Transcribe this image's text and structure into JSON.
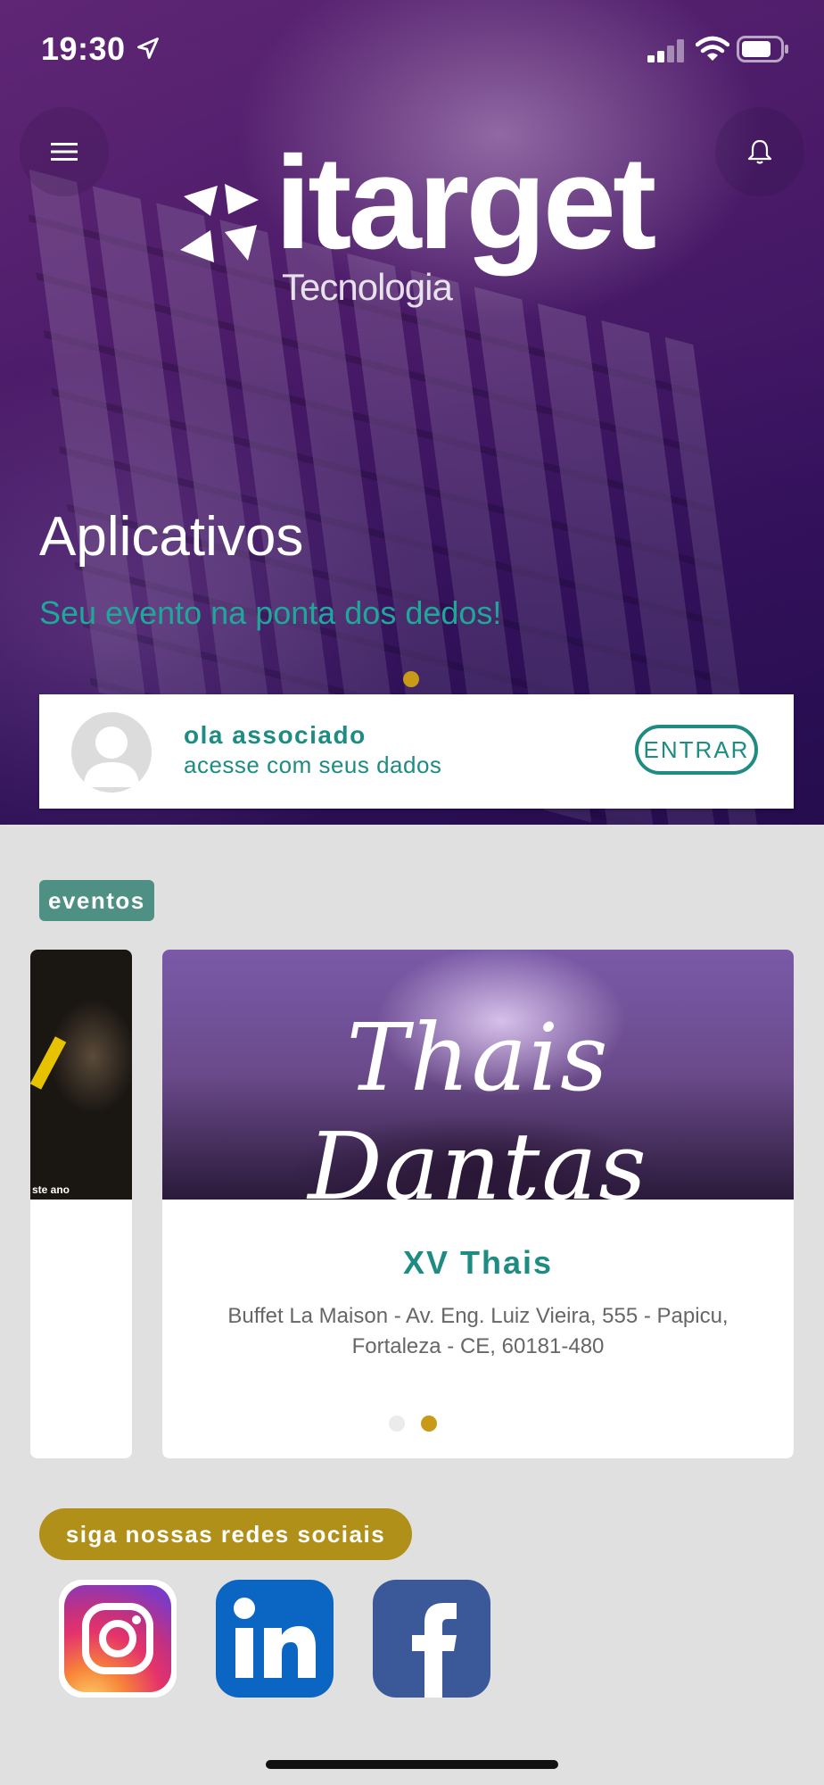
{
  "status_bar": {
    "time": "19:30"
  },
  "header": {
    "menu_icon": "menu-icon",
    "bell_icon": "bell-icon"
  },
  "brand": {
    "name": "itarget",
    "subtitle": "Tecnologia"
  },
  "hero": {
    "title": "Aplicativos",
    "subtitle": "Seu evento na ponta dos dedos!",
    "slide_count": 1,
    "active_slide": 1
  },
  "login": {
    "greeting": "ola associado",
    "subtext": "acesse com seus dados",
    "button": "ENTRAR"
  },
  "events": {
    "section_label": "eventos",
    "previous_card": {
      "caption": "ste ano"
    },
    "current_card": {
      "image_title": "Thais Dantas",
      "title": "XV Thais",
      "address": "Buffet La Maison - Av. Eng. Luiz Vieira, 555 - Papicu, Fortaleza - CE, 60181-480"
    },
    "page_count": 2,
    "active_page": 2
  },
  "social": {
    "label": "siga nossas redes sociais",
    "items": [
      {
        "name": "Instagram",
        "icon": "instagram-icon"
      },
      {
        "name": "LinkedIn",
        "icon": "linkedin-icon"
      },
      {
        "name": "Facebook",
        "icon": "facebook-icon"
      }
    ]
  },
  "colors": {
    "teal": "#1e8c82",
    "gold": "#c89a18",
    "tag_green": "#4f9085",
    "social_gold": "#b1901a",
    "background": "#e0e0e0"
  }
}
